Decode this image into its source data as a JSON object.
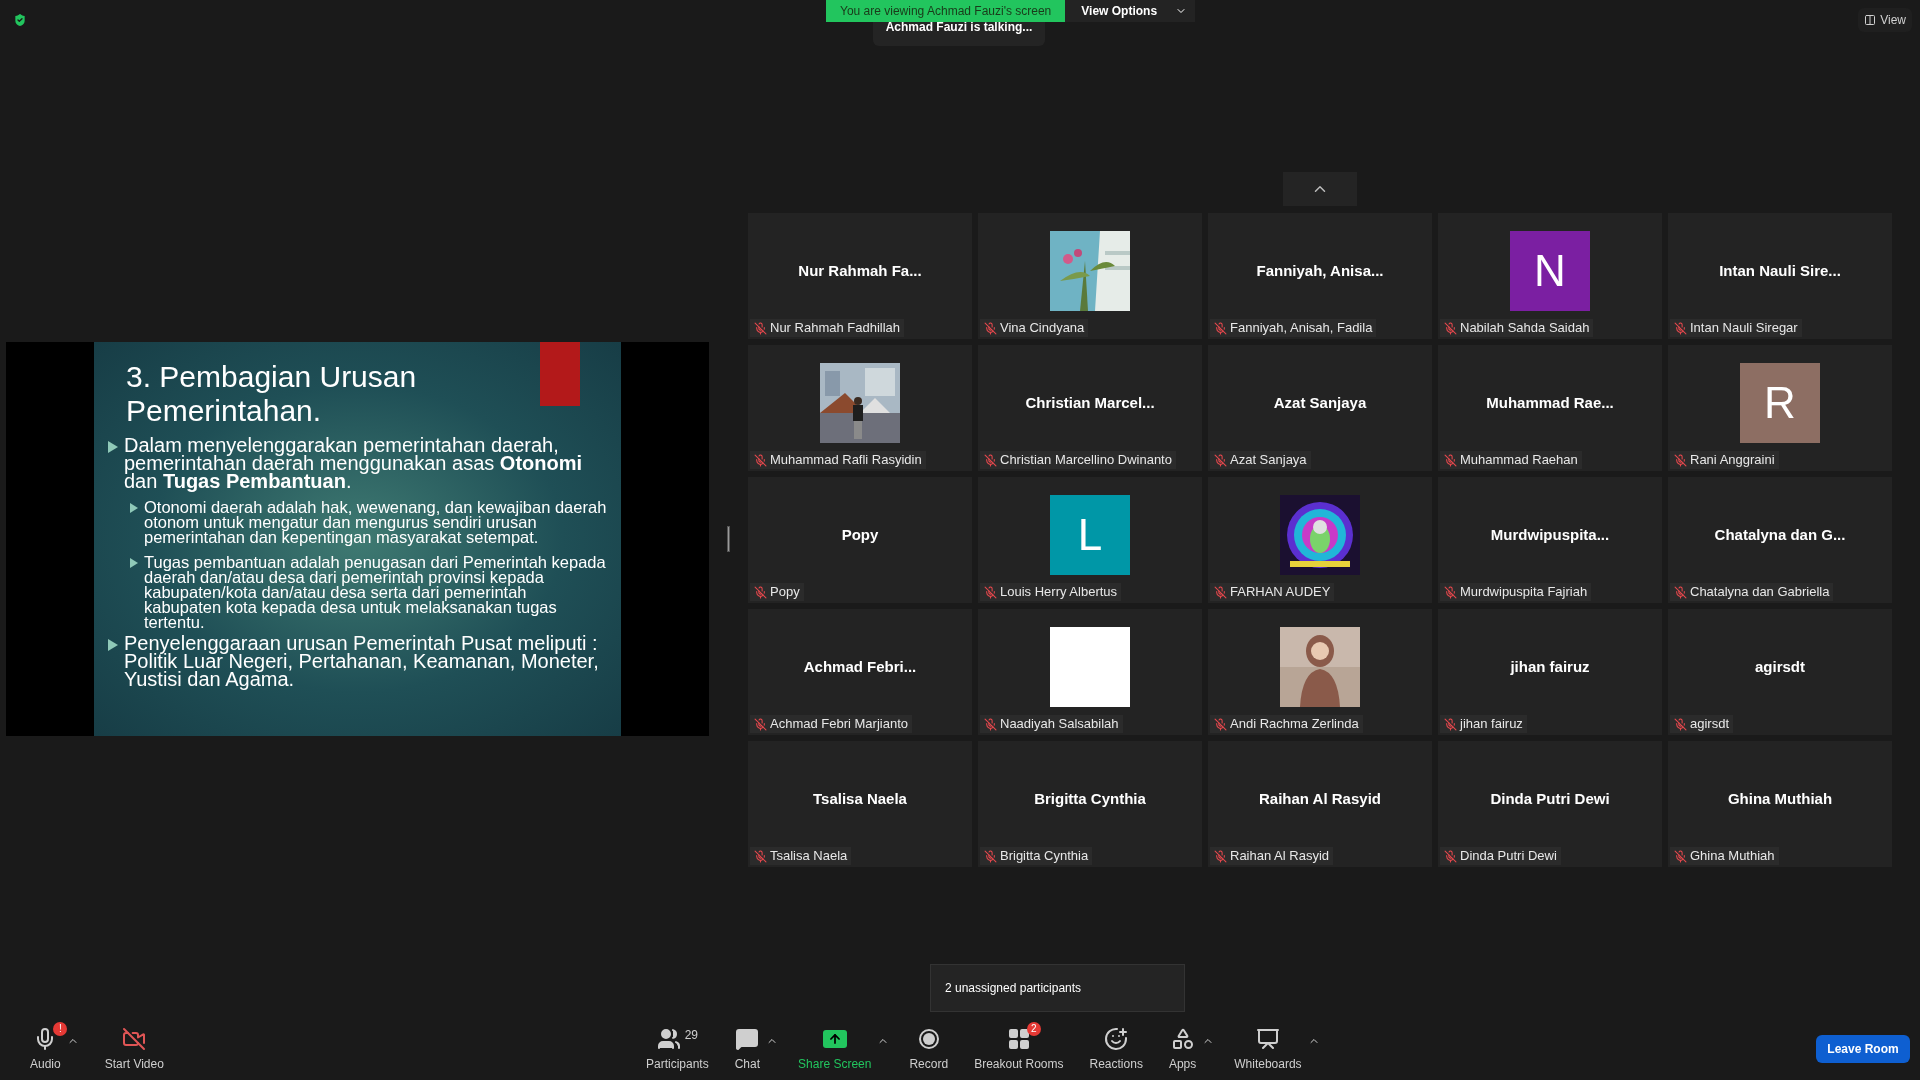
{
  "banner": {
    "text": "You are viewing Achmad Fauzi's screen",
    "options": "View Options"
  },
  "talking": "Achmad Fauzi is talking...",
  "view_button": "View",
  "slide": {
    "title": "3. Pembagian Urusan Pemerintahan.",
    "bullets": [
      {
        "text": "Dalam menyelenggarakan pemerintahan daerah, pemerintahan daerah menggunakan asas **Otonomi** dan **Tugas Pembantuan**.",
        "children": [
          {
            "text": "Otonomi daerah adalah hak, wewenang, dan kewajiban daerah otonom untuk mengatur dan mengurus sendiri urusan pemerintahan dan kepentingan masyarakat setempat."
          },
          {
            "text": "Tugas pembantuan adalah penugasan dari Pemerintah kepada daerah dan/atau desa dari pemerintah provinsi kepada kabupaten/kota dan/atau desa serta dari pemerintah kabupaten kota kepada desa untuk melaksanakan tugas tertentu."
          }
        ]
      },
      {
        "text": "Penyelenggaraan urusan Pemerintah Pusat meliputi : Politik Luar Negeri, Pertahanan, Keamanan, Moneter, Yustisi dan Agama."
      }
    ]
  },
  "tiles": [
    {
      "kind": "name",
      "display": "Nur Rahmah Fa...",
      "label": "Nur Rahmah Fadhillah",
      "muted": true
    },
    {
      "kind": "picture",
      "label": "Vina Cindyana",
      "muted": true
    },
    {
      "kind": "name",
      "display": "Fanniyah, Anisa...",
      "label": "Fanniyah, Anisah, Fadila",
      "muted": true
    },
    {
      "kind": "avatar",
      "letter": "N",
      "color": "#7b1fa2",
      "label": "Nabilah Sahda Saidah",
      "muted": true
    },
    {
      "kind": "name",
      "display": "Intan Nauli Sire...",
      "label": "Intan Nauli Siregar",
      "muted": true
    },
    {
      "kind": "picture",
      "label": "Muhammad Rafli Rasyidin",
      "muted": true
    },
    {
      "kind": "name",
      "display": "Christian Marcel...",
      "label": "Christian Marcellino Dwinanto",
      "muted": true
    },
    {
      "kind": "name",
      "display": "Azat Sanjaya",
      "label": "Azat Sanjaya",
      "muted": true
    },
    {
      "kind": "name",
      "display": "Muhammad Rae...",
      "label": "Muhammad Raehan",
      "muted": true
    },
    {
      "kind": "avatar",
      "letter": "R",
      "color": "#8d6e63",
      "label": "Rani Anggraini",
      "muted": true
    },
    {
      "kind": "name",
      "display": "Popy",
      "label": "Popy",
      "muted": true
    },
    {
      "kind": "avatar",
      "letter": "L",
      "color": "#0097a7",
      "label": "Louis Herry Albertus",
      "muted": true
    },
    {
      "kind": "picture",
      "label": "FARHAN AUDEY",
      "muted": true
    },
    {
      "kind": "name",
      "display": "Murdwipuspita...",
      "label": "Murdwipuspita Fajriah",
      "muted": true
    },
    {
      "kind": "name",
      "display": "Chatalyna dan G...",
      "label": "Chatalyna dan Gabriella",
      "muted": true
    },
    {
      "kind": "name",
      "display": "Achmad Febri...",
      "label": "Achmad Febri Marjianto",
      "muted": true
    },
    {
      "kind": "blank",
      "label": "Naadiyah Salsabilah",
      "muted": true
    },
    {
      "kind": "picture",
      "label": "Andi Rachma Zerlinda",
      "muted": true
    },
    {
      "kind": "name",
      "display": "jihan fairuz",
      "label": "jihan fairuz",
      "muted": true
    },
    {
      "kind": "name",
      "display": "agirsdt",
      "label": "agirsdt",
      "muted": true
    },
    {
      "kind": "name",
      "display": "Tsalisa Naela",
      "label": "Tsalisa Naela",
      "muted": true
    },
    {
      "kind": "name",
      "display": "Brigitta Cynthia",
      "label": "Brigitta Cynthia",
      "muted": true
    },
    {
      "kind": "name",
      "display": "Raihan Al Rasyid",
      "label": "Raihan Al Rasyid",
      "muted": true
    },
    {
      "kind": "name",
      "display": "Dinda Putri Dewi",
      "label": "Dinda Putri Dewi",
      "muted": true
    },
    {
      "kind": "name",
      "display": "Ghina Muthiah",
      "label": "Ghina Muthiah",
      "muted": true
    }
  ],
  "tooltip": "2 unassigned participants",
  "toolbar_left": [
    {
      "kind": "audio",
      "label": "Audio",
      "badge": "!",
      "caret": true
    },
    {
      "kind": "video",
      "label": "Start Video"
    }
  ],
  "toolbar_center": [
    {
      "kind": "participants",
      "label": "Participants",
      "count": "29"
    },
    {
      "kind": "chat",
      "label": "Chat",
      "caret": true
    },
    {
      "kind": "share",
      "label": "Share Screen",
      "caret": true
    },
    {
      "kind": "record",
      "label": "Record"
    },
    {
      "kind": "breakout",
      "label": "Breakout Rooms",
      "badge": "2"
    },
    {
      "kind": "reactions",
      "label": "Reactions"
    },
    {
      "kind": "apps",
      "label": "Apps",
      "caret": true
    },
    {
      "kind": "whiteboards",
      "label": "Whiteboards",
      "caret": true
    }
  ],
  "leave_button": "Leave Room"
}
